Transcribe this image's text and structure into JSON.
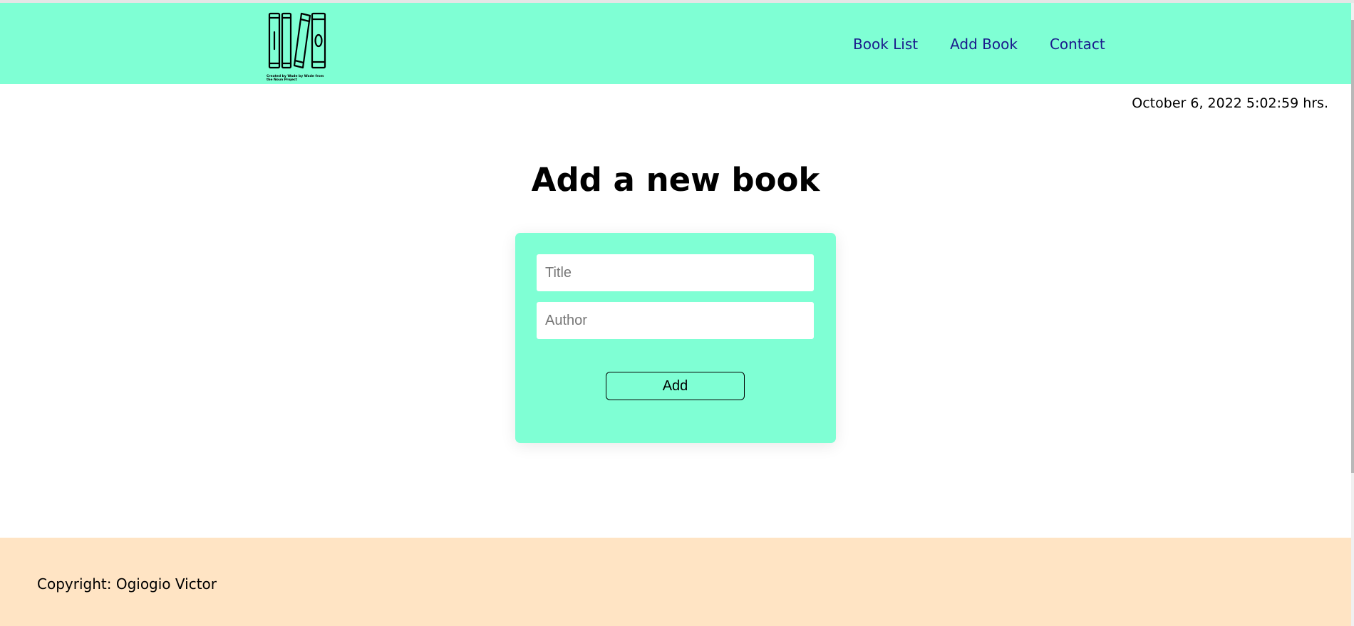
{
  "header": {
    "logo_icon": "bookshelf-icon",
    "logo_credit": "Created by Wade by Wade from the Noun Project",
    "nav": [
      {
        "label": "Book List"
      },
      {
        "label": "Add Book"
      },
      {
        "label": "Contact"
      }
    ],
    "background_color": "#7fffd4",
    "link_color": "#1a1a8c"
  },
  "datetime": "October 6, 2022 5:02:59 hrs.",
  "main": {
    "heading": "Add a new book",
    "form": {
      "title_placeholder": "Title",
      "title_value": "",
      "author_placeholder": "Author",
      "author_value": "",
      "add_label": "Add"
    }
  },
  "footer": {
    "copyright": "Copyright: Ogiogio Victor",
    "background_color": "#ffe4c4"
  }
}
